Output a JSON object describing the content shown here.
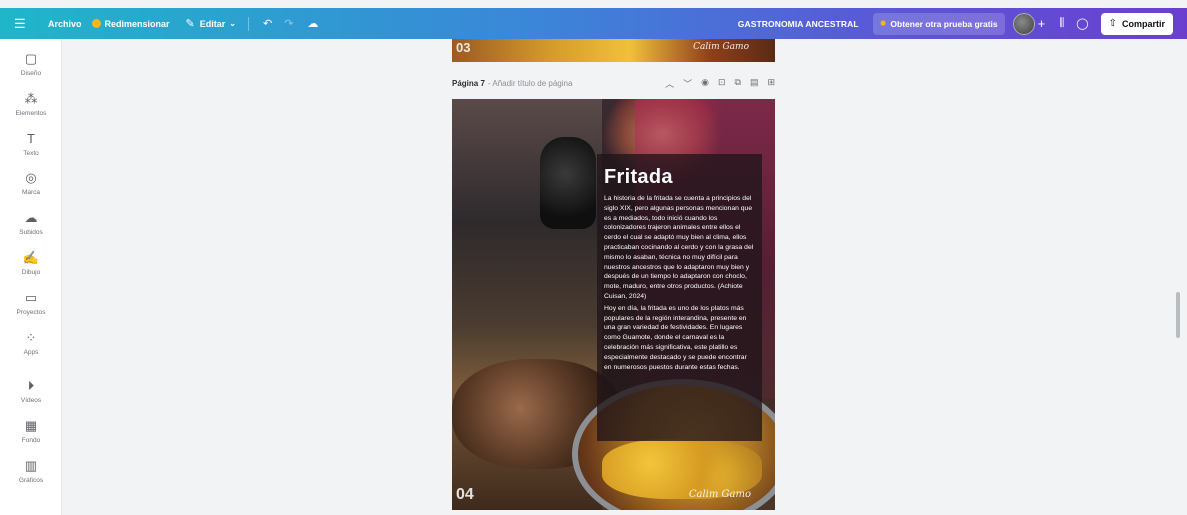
{
  "topbar": {
    "menu_icon": "hamburger-menu-icon",
    "file_label": "Archivo",
    "resize_label": "Redimensionar",
    "edit_label": "Editar",
    "doc_title": "GASTRONOMIA ANCESTRAL",
    "trial_label": "Obtener otra prueba gratis",
    "share_label": "Compartir",
    "gradient_start": "#1fb6c9",
    "gradient_end": "#6a3fd0"
  },
  "sidebar": {
    "items": [
      {
        "label": "Diseño",
        "icon": "layout-icon"
      },
      {
        "label": "Elementos",
        "icon": "elements-icon"
      },
      {
        "label": "Texto",
        "icon": "text-icon"
      },
      {
        "label": "Marca",
        "icon": "brand-icon"
      },
      {
        "label": "Subidos",
        "icon": "upload-cloud-icon"
      },
      {
        "label": "Dibujo",
        "icon": "draw-icon"
      },
      {
        "label": "Proyectos",
        "icon": "folder-icon"
      },
      {
        "label": "Apps",
        "icon": "apps-icon"
      },
      {
        "label": "Vídeos",
        "icon": "video-icon"
      },
      {
        "label": "Fondo",
        "icon": "background-icon"
      },
      {
        "label": "Gráficos",
        "icon": "charts-icon"
      }
    ]
  },
  "canvas": {
    "prev_page_number": "03",
    "page_label": "Página 7",
    "page_title_placeholder": "- Añadir título de página",
    "page_number": "04",
    "title": "Fritada",
    "paragraph1": "La historia de la fritada se cuenta a principios del siglo XIX, pero algunas personas mencionan que es a mediados, todo inició cuando los colonizadores trajeron animales entre ellos el cerdo el cual se adaptó muy bien al clima, ellos practicaban cocinando al cerdo y con la grasa del mismo lo asaban, técnica no muy difícil para nuestros ancestros que lo adaptaron muy bien y después de un tiempo lo adaptaron con choclo, mote, maduro, entre otros productos. (Achiote Cuisan, 2024)",
    "paragraph2": "Hoy en día, la fritada es uno de los platos más populares de la región interandina, presente en una gran variedad de festividades. En lugares como Guamote, donde el carnaval es la celebración más significativa, este platillo es especialmente destacado y se puede encontrar en numerosos puestos durante estas fechas."
  }
}
